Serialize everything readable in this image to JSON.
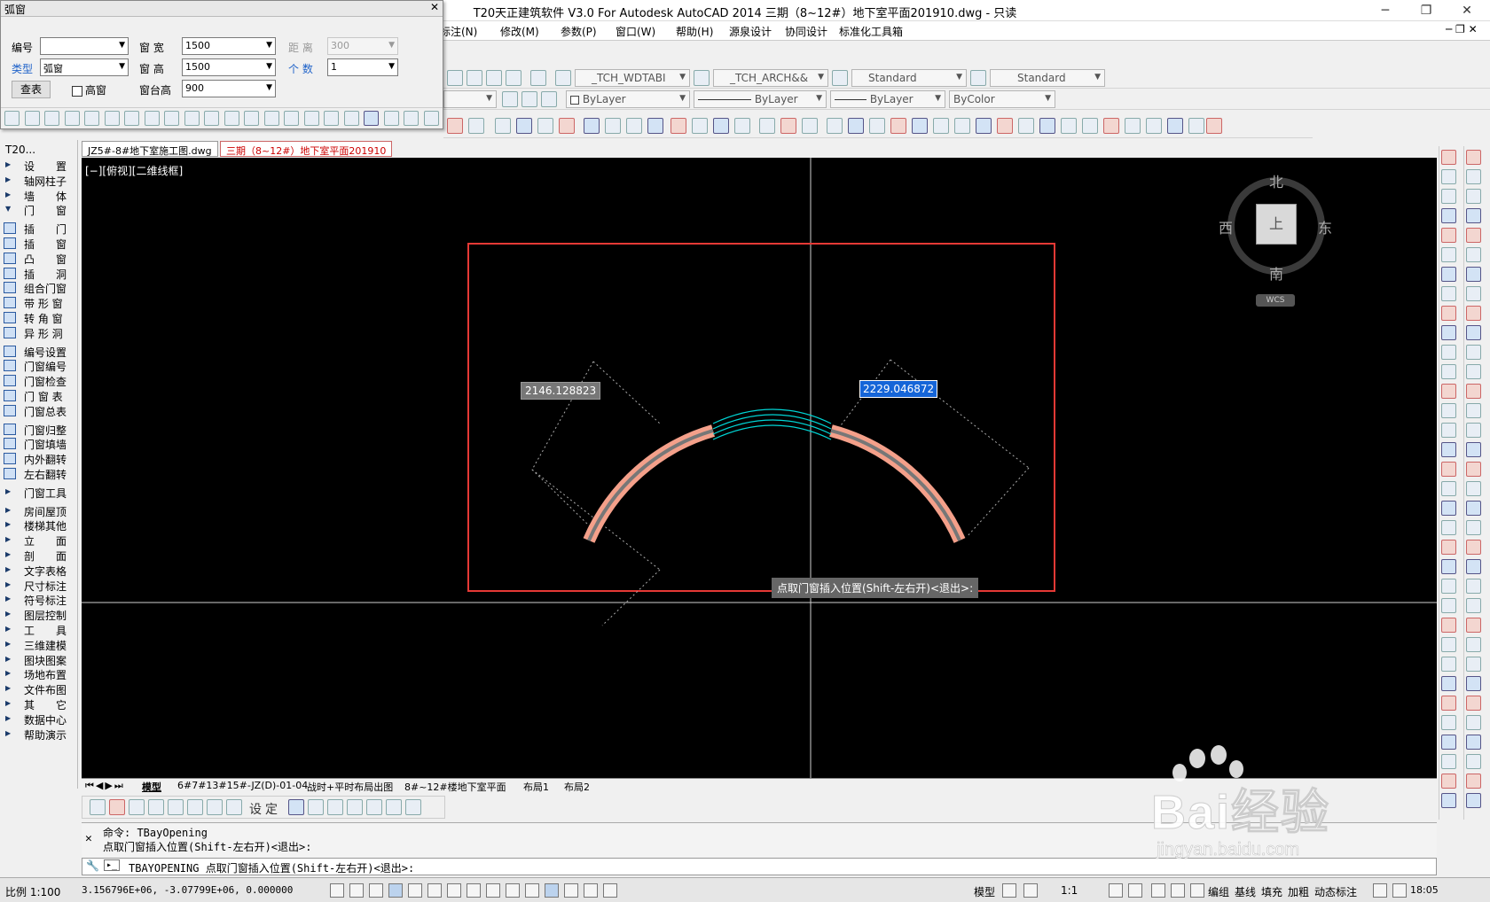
{
  "window": {
    "title": "T20天正建筑软件 V3.0 For Autodesk AutoCAD 2014    三期（8~12#）地下室平面201910.dwg - 只读",
    "min": "─",
    "max": "❐",
    "close": "✕"
  },
  "menu": [
    "标注(N)",
    "修改(M)",
    "参数(P)",
    "窗口(W)",
    "帮助(H)",
    "源泉设计",
    "协同设计",
    "标准化工具箱"
  ],
  "toolbar": {
    "text_style_1": "_TCH_WDTABI",
    "text_style_2": "_TCH_ARCH&&",
    "dim_style_1": "Standard",
    "dim_style_2": "Standard",
    "layer_color": "ByLayer",
    "linetype": "ByLayer",
    "lineweight": "ByLayer",
    "plot_style": "ByColor"
  },
  "dialog": {
    "title": "弧窗",
    "labels": {
      "number": "编号",
      "type": "类型",
      "width": "窗 宽",
      "height": "窗 高",
      "sill": "窗台高",
      "distance": "距 离",
      "count": "个 数"
    },
    "values": {
      "number": "",
      "type": "弧窗",
      "width": "1500",
      "height": "1500",
      "sill": "900",
      "distance": "300",
      "count": "1"
    },
    "lookup_button": "查表",
    "high_window_checkbox": "高窗",
    "close": "✕"
  },
  "left_panel": {
    "title": "T20...",
    "items": [
      {
        "label": "设　　置",
        "kind": "tri"
      },
      {
        "label": "轴网柱子",
        "kind": "tri"
      },
      {
        "label": "墙　　体",
        "kind": "tri"
      },
      {
        "label": "门　　窗",
        "kind": "tri-open"
      },
      {
        "label": "插　　门",
        "kind": "icon"
      },
      {
        "label": "插　　窗",
        "kind": "icon"
      },
      {
        "label": "凸　　窗",
        "kind": "icon"
      },
      {
        "label": "插　　洞",
        "kind": "icon"
      },
      {
        "label": "组合门窗",
        "kind": "icon"
      },
      {
        "label": "带 形 窗",
        "kind": "icon"
      },
      {
        "label": "转 角 窗",
        "kind": "icon"
      },
      {
        "label": "异 形 洞",
        "kind": "icon"
      },
      {
        "label": "编号设置",
        "kind": "icon"
      },
      {
        "label": "门窗编号",
        "kind": "icon"
      },
      {
        "label": "门窗检查",
        "kind": "icon"
      },
      {
        "label": "门 窗 表",
        "kind": "icon"
      },
      {
        "label": "门窗总表",
        "kind": "icon"
      },
      {
        "label": "门窗归整",
        "kind": "icon"
      },
      {
        "label": "门窗填墙",
        "kind": "icon"
      },
      {
        "label": "内外翻转",
        "kind": "icon"
      },
      {
        "label": "左右翻转",
        "kind": "icon"
      },
      {
        "label": "门窗工具",
        "kind": "tri"
      },
      {
        "label": "房间屋顶",
        "kind": "tri"
      },
      {
        "label": "楼梯其他",
        "kind": "tri"
      },
      {
        "label": "立　　面",
        "kind": "tri"
      },
      {
        "label": "剖　　面",
        "kind": "tri"
      },
      {
        "label": "文字表格",
        "kind": "tri"
      },
      {
        "label": "尺寸标注",
        "kind": "tri"
      },
      {
        "label": "符号标注",
        "kind": "tri"
      },
      {
        "label": "图层控制",
        "kind": "tri"
      },
      {
        "label": "工　　具",
        "kind": "tri"
      },
      {
        "label": "三维建模",
        "kind": "tri"
      },
      {
        "label": "图块图案",
        "kind": "tri"
      },
      {
        "label": "场地布置",
        "kind": "tri"
      },
      {
        "label": "文件布图",
        "kind": "tri"
      },
      {
        "label": "其　　它",
        "kind": "tri"
      },
      {
        "label": "数据中心",
        "kind": "tri"
      },
      {
        "label": "帮助演示",
        "kind": "tri"
      }
    ]
  },
  "doc_tabs": [
    "JZ5#-8#地下室施工图.dwg",
    "三期（8~12#）地下室平面201910"
  ],
  "canvas": {
    "view_label": "[−][俯视][二维线框]",
    "dim_left": "2146.128823",
    "dim_right": "2229.046872",
    "tooltip": "点取门窗插入位置(Shift-左右开)<退出>:",
    "viewcube": {
      "north": "北",
      "south": "南",
      "east": "东",
      "west": "西",
      "top": "上",
      "wcs": "WCS"
    }
  },
  "layout_tabs": [
    "模型",
    "6#7#13#15#-JZ(D)-01-04",
    "战时+平时布局出图",
    "8#~12#楼地下室平面",
    "布局1",
    "布局2"
  ],
  "bottom_toolbar": {
    "set_label": "设",
    "fix_label": "定"
  },
  "command": {
    "history_1": "命令: TBayOpening",
    "history_2": "点取门窗插入位置(Shift-左右开)<退出>:",
    "current": "TBAYOPENING 点取门窗插入位置(Shift-左右开)<退出>:",
    "prompt_icon": "▸_"
  },
  "status": {
    "scale": "比例 1:100",
    "coords": "3.156796E+06, -3.07799E+06, 0.000000",
    "model": "模型",
    "annotation_scale": "1:1",
    "toggles": [
      "编组",
      "基线",
      "填充",
      "加粗",
      "动态标注"
    ],
    "time": "18:05"
  },
  "watermark": {
    "brand": "Bai经验",
    "url": "jingyan.baidu.com"
  }
}
